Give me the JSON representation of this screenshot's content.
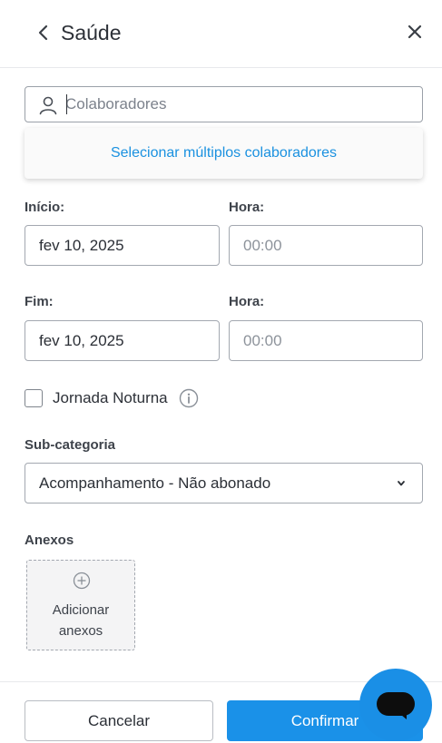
{
  "header": {
    "title": "Saúde"
  },
  "collaborators": {
    "placeholder": "Colaboradores",
    "dropdown_option": "Selecionar múltiplos colaboradores"
  },
  "start": {
    "date_label": "Início:",
    "date_value": "fev 10, 2025",
    "time_label": "Hora:",
    "time_placeholder": "00:00"
  },
  "end": {
    "date_label": "Fim:",
    "date_value": "fev 10, 2025",
    "time_label": "Hora:",
    "time_placeholder": "00:00"
  },
  "night_shift": {
    "label": "Jornada Noturna",
    "checked": false
  },
  "subcategory": {
    "label": "Sub-categoria",
    "selected": "Acompanhamento - Não abonado"
  },
  "attachments": {
    "label": "Anexos",
    "add_line1": "Adicionar",
    "add_line2": "anexos"
  },
  "footer": {
    "cancel_label": "Cancelar",
    "confirm_label": "Confirmar"
  },
  "colors": {
    "primary": "#1a91e8",
    "link": "#1a91e0",
    "border": "#a3a8b0"
  },
  "icons": [
    "chevron-left-icon",
    "close-icon",
    "user-icon",
    "info-icon",
    "chevron-down-icon",
    "plus-circle-icon",
    "chat-icon"
  ]
}
